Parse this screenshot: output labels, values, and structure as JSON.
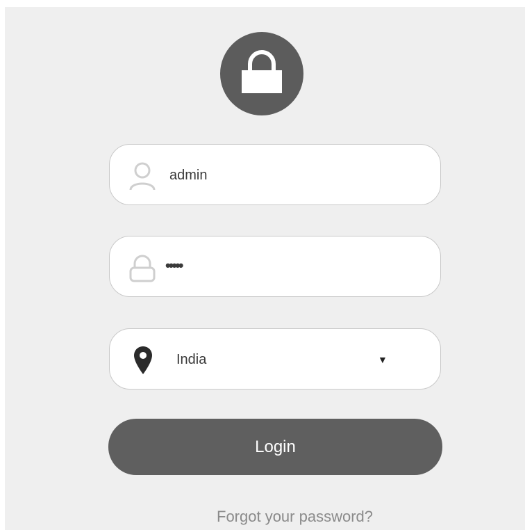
{
  "logo": {
    "icon": "lock-icon"
  },
  "username": {
    "icon": "user-icon",
    "value": "admin"
  },
  "password": {
    "icon": "lock-outline-icon",
    "value": "•••••"
  },
  "country": {
    "icon": "map-pin-icon",
    "selected": "India",
    "caret": "▼"
  },
  "login": {
    "label": "Login"
  },
  "forgot": {
    "label": "Forgot your password?"
  },
  "colors": {
    "background": "#efefef",
    "accent": "#5c5c5c",
    "field_border": "#c9c9c9",
    "link": "#8a8a8a"
  }
}
